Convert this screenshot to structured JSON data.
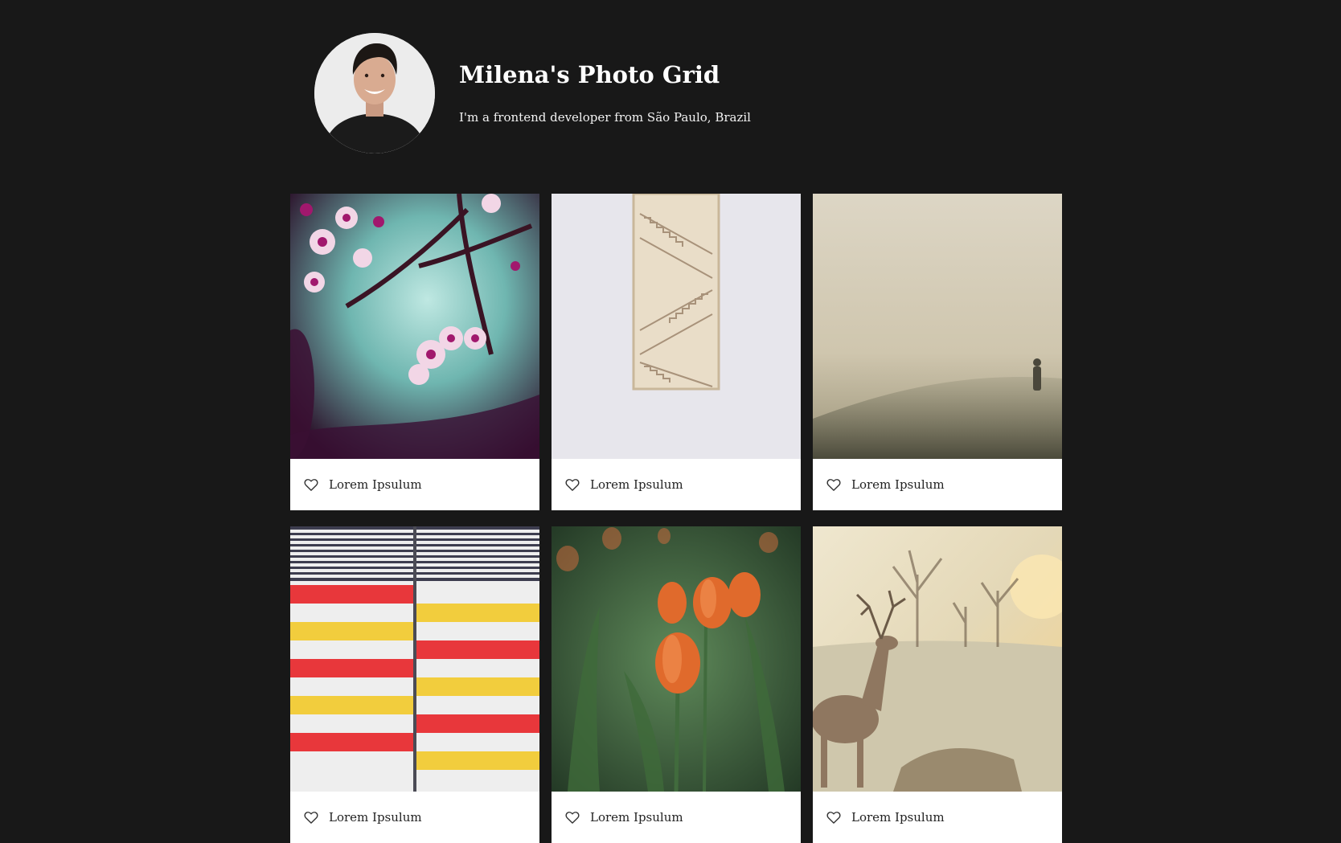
{
  "profile": {
    "title": "Milena's Photo Grid",
    "bio": "I'm a frontend developer from São Paulo, Brazil",
    "avatar_alt": "profile photo"
  },
  "photos": [
    {
      "subject": "pink cherry blossoms on a branch",
      "caption": "Lorem Ipsulum"
    },
    {
      "subject": "staircase seen through a narrow window",
      "caption": "Lorem Ipsulum"
    },
    {
      "subject": "person standing on a foggy hill",
      "caption": "Lorem Ipsulum"
    },
    {
      "subject": "red yellow and white striped facade",
      "caption": "Lorem Ipsulum"
    },
    {
      "subject": "orange tulips",
      "caption": "Lorem Ipsulum"
    },
    {
      "subject": "deer in a misty park at sunrise",
      "caption": "Lorem Ipsulum"
    }
  ],
  "icons": {
    "like": "heart-outline-icon"
  },
  "colors": {
    "background": "#181818",
    "card": "#ffffff",
    "text": "#ffffff",
    "caption_text": "#222222"
  }
}
